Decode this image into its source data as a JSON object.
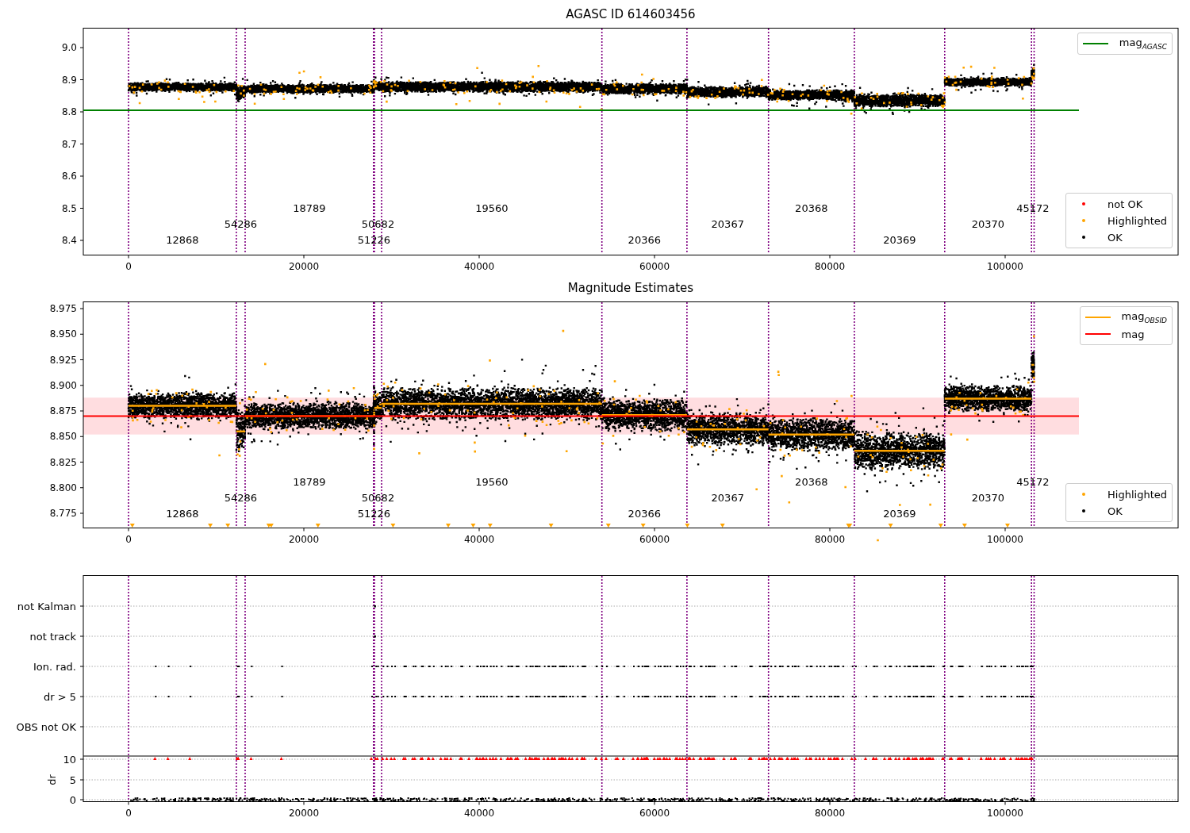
{
  "figure": {
    "panels": [
      {
        "kind": "magnitude",
        "title": "AGASC ID 614603456",
        "xticks": [
          "0",
          "20000",
          "40000",
          "60000",
          "80000",
          "100000"
        ],
        "yticks": [
          "9.0",
          "8.9",
          "8.8",
          "8.7",
          "8.6",
          "8.5",
          "8.4"
        ],
        "obsids": [
          "12868",
          "54286",
          "18789",
          "51226",
          "50682",
          "19560",
          "20366",
          "20367",
          "20368",
          "20369",
          "20370",
          "45172"
        ],
        "line_legend": [
          {
            "label": "mag$_{AGASC}$",
            "color": "#008000"
          }
        ],
        "point_legend": [
          {
            "label": "not OK",
            "color": "#ff0000"
          },
          {
            "label": "Highlighted",
            "color": "#ffa500"
          },
          {
            "label": "OK",
            "color": "#000000"
          }
        ]
      },
      {
        "kind": "estimates",
        "title": "Magnitude Estimates",
        "xticks": [
          "0",
          "20000",
          "40000",
          "60000",
          "80000",
          "100000"
        ],
        "yticks": [
          "8.975",
          "8.950",
          "8.925",
          "8.900",
          "8.875",
          "8.850",
          "8.825",
          "8.800",
          "8.775"
        ],
        "obsids": [
          "12868",
          "54286",
          "18789",
          "51226",
          "50682",
          "19560",
          "20366",
          "20367",
          "20368",
          "20369",
          "20370",
          "45172"
        ],
        "line_legend": [
          {
            "label": "mag$_{OBSID}$",
            "color": "#ffa500"
          },
          {
            "label": "mag",
            "color": "#ff0000"
          }
        ],
        "point_legend": [
          {
            "label": "Highlighted",
            "color": "#ffa500"
          },
          {
            "label": "OK",
            "color": "#000000"
          }
        ]
      },
      {
        "kind": "flags",
        "xticks": [
          "0",
          "20000",
          "40000",
          "60000",
          "80000",
          "100000"
        ],
        "rows": [
          "not Kalman",
          "not track",
          "Ion. rad.",
          "dr > 5",
          "OBS not OK"
        ],
        "dr_label": "dr",
        "dr_ticks": [
          "10",
          "5",
          "0"
        ]
      }
    ]
  }
}
